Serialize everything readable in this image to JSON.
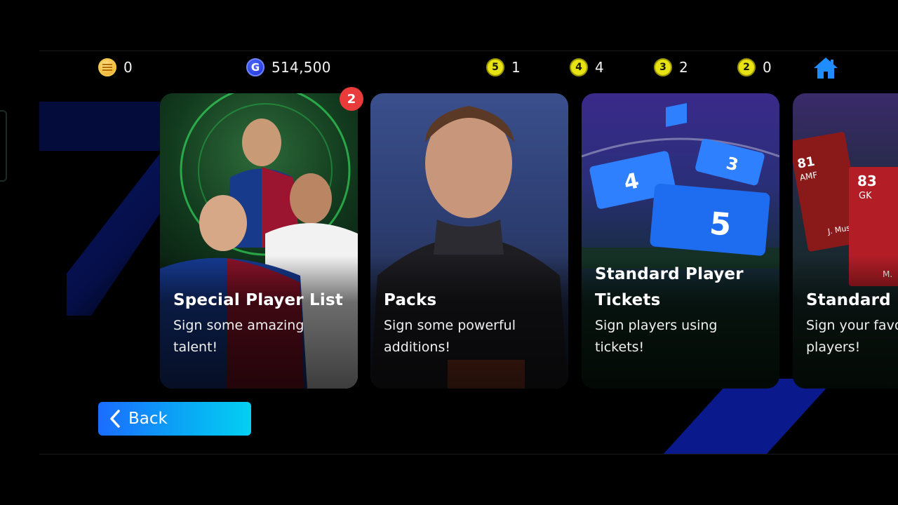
{
  "currencies": [
    {
      "icon": "coin-icon",
      "value": "0"
    },
    {
      "icon": "gp-icon",
      "symbol": "G",
      "value": "514,500"
    },
    {
      "icon": "ticket-5-icon",
      "symbol": "5",
      "value": "1"
    },
    {
      "icon": "ticket-4-icon",
      "symbol": "4",
      "value": "4"
    },
    {
      "icon": "ticket-3-icon",
      "symbol": "3",
      "value": "2"
    },
    {
      "icon": "ticket-2-icon",
      "symbol": "2",
      "value": "0"
    }
  ],
  "home_icon": "home-icon",
  "cards": [
    {
      "title": "Special Player List",
      "desc_1": "Sign some amazing",
      "desc_2": "talent!",
      "badge": "2"
    },
    {
      "title": "Packs",
      "desc_1": "Sign some powerful",
      "desc_2": "additions!"
    },
    {
      "title_1": "Standard Player",
      "title_2": "Tickets",
      "desc_1": "Sign players using",
      "desc_2": "tickets!",
      "art": {
        "ticket_big": "5",
        "ticket_mid": "4",
        "ticket_small": "3"
      }
    },
    {
      "title": "Standard Pl",
      "desc_1": "Sign your favo",
      "desc_2": "players!",
      "art": {
        "card1_rating": "81",
        "card1_pos": "AMF",
        "card1_name": "J. Musia",
        "card2_rating": "83",
        "card2_pos": "GK",
        "card2_name": "M."
      }
    }
  ],
  "back_label": "Back",
  "colors": {
    "accent_start": "#1b6cff",
    "accent_end": "#03d0f2",
    "badge": "#ea3b3b",
    "ticket_coin": "#e8e312"
  }
}
